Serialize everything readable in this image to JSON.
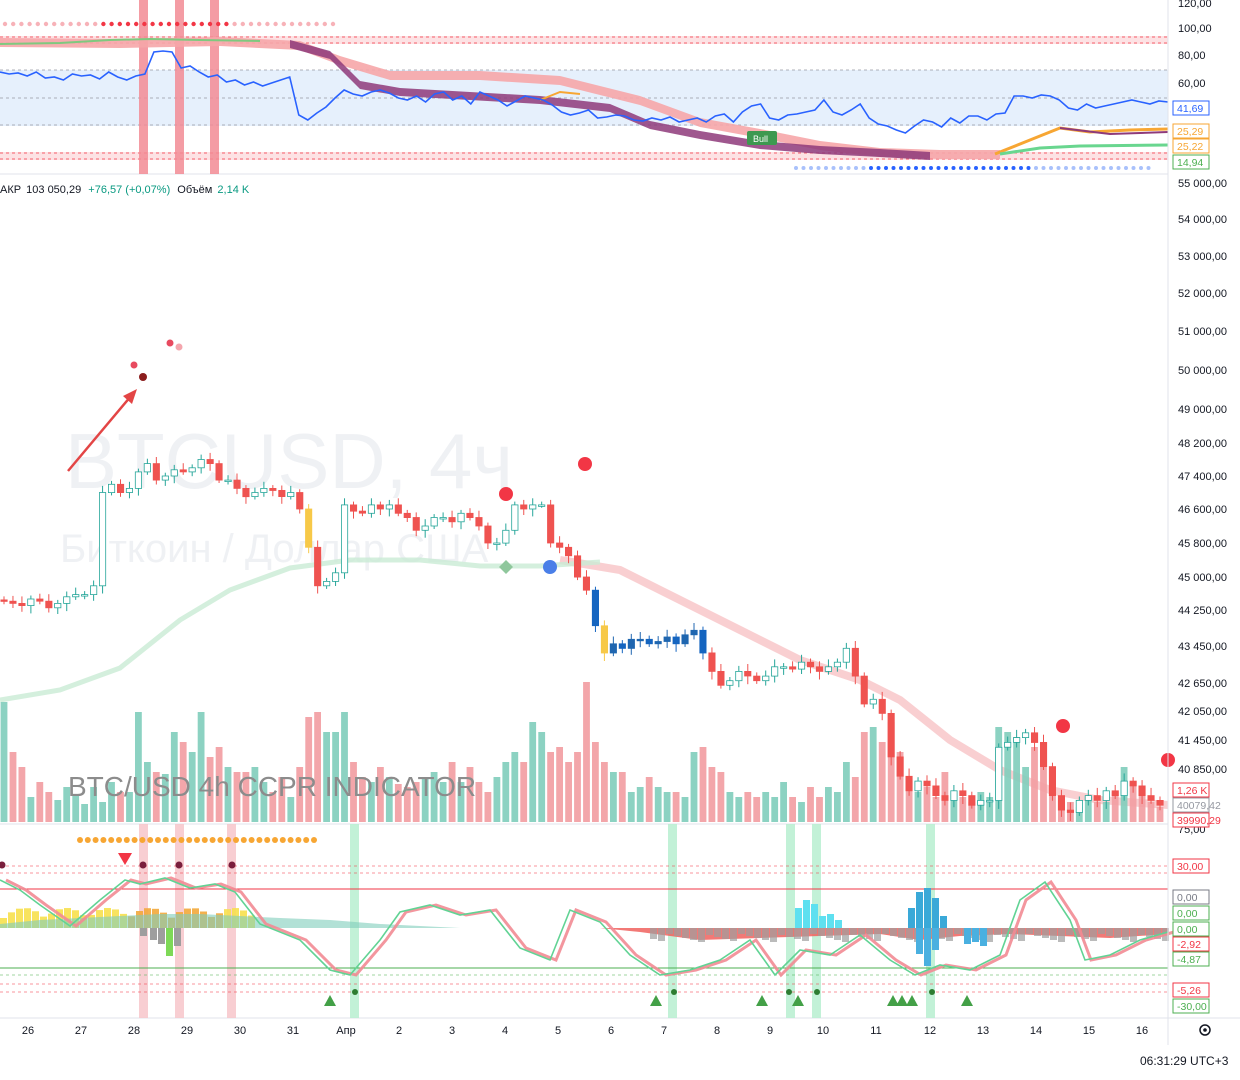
{
  "legend": {
    "symbol_cut": "АКР",
    "price": "103 050,29",
    "change": "+76,57 (+0,07%)",
    "volume_label": "Объём",
    "volume_value": "2,14 K"
  },
  "watermark": {
    "symbol": "BTCUSD, 4ч",
    "name": "Биткоин / Доллар США"
  },
  "overlay_title": "BTC/USD 4h  CCPR INDICATOR",
  "clock": "06:31:29 UTC+3",
  "top_pane": {
    "ticks": [
      "120,00",
      "100,00",
      "80,00",
      "60,00",
      "40,00"
    ],
    "badges": [
      {
        "text": "41,69",
        "color": "#2962ff",
        "fill": "#ffffff"
      },
      {
        "text": "25,29",
        "color": "#f7a633",
        "fill": "#ffffff"
      },
      {
        "text": "25,22",
        "color": "#f7a633",
        "fill": "#ffffff"
      },
      {
        "text": "14,94",
        "color": "#4caf50",
        "fill": "#ffffff"
      }
    ],
    "bull_label": "Bull"
  },
  "main_pane": {
    "ticks": [
      "55 000,00",
      "54 000,00",
      "53 000,00",
      "52 000,00",
      "51 000,00",
      "50 000,00",
      "49 000,00",
      "48 200,00",
      "47 400,00",
      "46 600,00",
      "45 800,00",
      "45 000,00",
      "44 250,00",
      "43 450,00",
      "42 650,00",
      "42 050,00",
      "41 450,00",
      "40 850,00"
    ],
    "badges": [
      {
        "text": "1,26 K",
        "color": "#f23645",
        "fill": "#ffffff"
      },
      {
        "text": "40079,42",
        "color": "#9598a1",
        "fill": "#ffffff"
      },
      {
        "text": "39990,29",
        "color": "#f23645",
        "fill": "#ffffff"
      }
    ]
  },
  "bottom_pane": {
    "ticks": [
      "75,00"
    ],
    "badges": [
      {
        "text": "30,00",
        "color": "#f23645",
        "fill": "#ffffff"
      },
      {
        "text": "0,00",
        "color": "#787b86",
        "fill": "#ffffff"
      },
      {
        "text": "0,00",
        "color": "#4caf50",
        "fill": "#ffffff"
      },
      {
        "text": "0,00",
        "color": "#4caf50",
        "fill": "#ffffff"
      },
      {
        "text": "-2,92",
        "color": "#f23645",
        "fill": "#ffffff"
      },
      {
        "text": "-4,87",
        "color": "#4caf50",
        "fill": "#ffffff"
      },
      {
        "text": "-5,26",
        "color": "#f23645",
        "fill": "#ffffff"
      },
      {
        "text": "-30,00",
        "color": "#4caf50",
        "fill": "#ffffff"
      }
    ]
  },
  "x_axis": [
    "26",
    "27",
    "28",
    "29",
    "30",
    "31",
    "Апр",
    "2",
    "3",
    "4",
    "5",
    "6",
    "7",
    "8",
    "9",
    "10",
    "11",
    "12",
    "13",
    "14",
    "15",
    "16"
  ],
  "chart_data": {
    "type": "candlestick",
    "symbol": "BTCUSD",
    "timeframe": "4h",
    "x_labels": [
      "26",
      "27",
      "28",
      "29",
      "30",
      "31",
      "Апр",
      "2",
      "3",
      "4",
      "5",
      "6",
      "7",
      "8",
      "9",
      "10",
      "11",
      "12",
      "13",
      "14",
      "15",
      "16"
    ],
    "price_axis_range": [
      40000,
      55000
    ],
    "price_ticks": [
      55000,
      54000,
      53000,
      52000,
      51000,
      50000,
      49000,
      48200,
      47400,
      46600,
      45800,
      45000,
      44250,
      43450,
      42650,
      42050,
      41450,
      40850
    ],
    "oscillator_top_range": [
      0,
      120
    ],
    "oscillator_top_ticks": [
      120,
      100,
      80,
      60,
      40
    ],
    "oscillator_top_last_values": {
      "blue": 41.69,
      "orange_a": 25.29,
      "orange_b": 25.22,
      "green": 14.94
    },
    "bottom_oscillator_ticks": [
      75,
      30
    ],
    "bottom_oscillator_last_values": [
      0.0,
      0.0,
      0.0,
      -2.92,
      -4.87,
      -5.26,
      -30.0
    ],
    "last_volume": "1,26 K",
    "last_prices": [
      40079.42,
      39990.29
    ],
    "closes_approx": [
      44450,
      44400,
      44350,
      44500,
      44450,
      44300,
      44400,
      44550,
      44600,
      44600,
      44800,
      47000,
      47200,
      47000,
      47100,
      47500,
      47700,
      47300,
      47400,
      47550,
      47500,
      47600,
      47800,
      47700,
      47300,
      47300,
      47100,
      46900,
      47000,
      47100,
      47050,
      46900,
      47000,
      46600,
      45700,
      44800,
      44900,
      45100,
      46700,
      46550,
      46500,
      46700,
      46600,
      46700,
      46500,
      46400,
      46100,
      46200,
      46400,
      46400,
      46300,
      46500,
      46400,
      46200,
      45800,
      45800,
      46100,
      46700,
      46600,
      46700,
      46700,
      45800,
      45700,
      45500,
      45000,
      44700,
      43900,
      43300,
      43500,
      43400,
      43600,
      43600,
      43500,
      43550,
      43650,
      43500,
      43700,
      43800,
      43300,
      42900,
      42600,
      42700,
      42900,
      42800,
      42700,
      42800,
      43000,
      43000,
      42950,
      43100,
      43000,
      42900,
      43000,
      43100,
      43400,
      42800,
      42200,
      42300,
      42000,
      41100,
      40700,
      40400,
      40600,
      40500,
      40300,
      40200,
      40400,
      40300,
      40100,
      40200,
      40200,
      41300,
      41400,
      41500,
      41600,
      41400,
      40900,
      40300,
      40000,
      39950,
      40200,
      40300,
      40200,
      40400,
      40300,
      40600,
      40500,
      40300,
      40200,
      40100
    ]
  }
}
